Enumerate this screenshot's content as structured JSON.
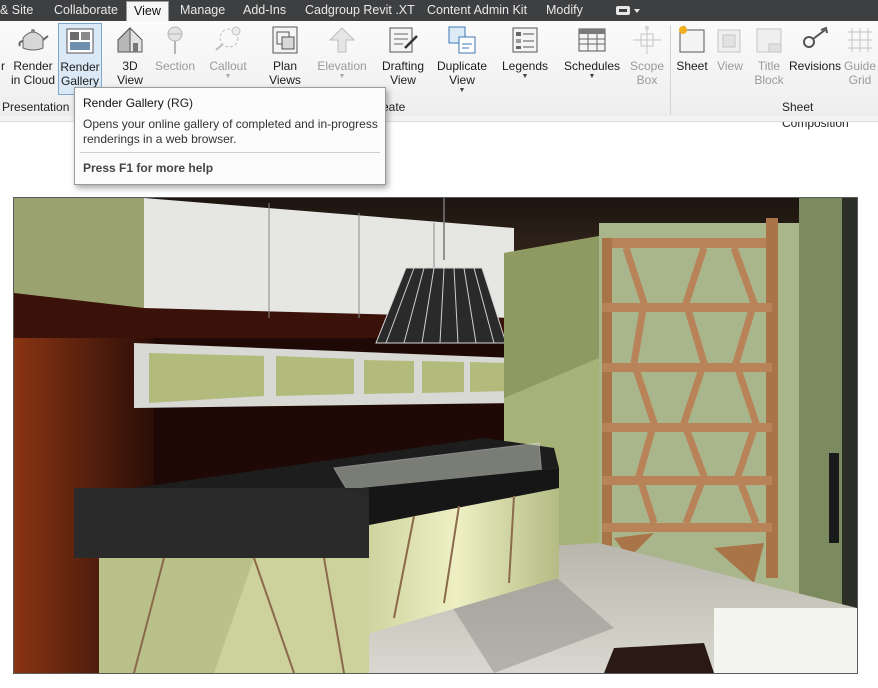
{
  "ribbon": {
    "tabs": [
      {
        "label": "& Site",
        "active": false
      },
      {
        "label": "Collaborate",
        "active": false
      },
      {
        "label": "View",
        "active": true
      },
      {
        "label": "Manage",
        "active": false
      },
      {
        "label": "Add-Ins",
        "active": false
      },
      {
        "label": "Cadgroup Revit .XT",
        "active": false
      },
      {
        "label": "Content Admin Kit",
        "active": false
      },
      {
        "label": "Modify",
        "active": false
      }
    ],
    "tools": [
      {
        "label": "r",
        "icon": "partial-tool-icon",
        "enabled": true
      },
      {
        "label": "Render\nin Cloud",
        "icon": "teapot-cloud-icon",
        "enabled": true
      },
      {
        "label": "Render\nGallery",
        "icon": "render-gallery-icon",
        "enabled": true
      },
      {
        "label": "3D\nView",
        "icon": "house-3d-icon",
        "enabled": true
      },
      {
        "label": "Section",
        "icon": "section-icon",
        "enabled": false
      },
      {
        "label": "Callout",
        "icon": "callout-icon",
        "enabled": false
      },
      {
        "label": "Plan\nViews",
        "icon": "plan-views-icon",
        "enabled": true
      },
      {
        "label": "Elevation",
        "icon": "elevation-icon",
        "enabled": false
      },
      {
        "label": "Drafting\nView",
        "icon": "drafting-view-icon",
        "enabled": true
      },
      {
        "label": "Duplicate\nView",
        "icon": "duplicate-view-icon",
        "enabled": true
      },
      {
        "label": "Legends",
        "icon": "legends-icon",
        "enabled": true
      },
      {
        "label": "Schedules",
        "icon": "schedules-icon",
        "enabled": true
      },
      {
        "label": "Scope\nBox",
        "icon": "scope-box-icon",
        "enabled": false
      },
      {
        "label": "Sheet",
        "icon": "sheet-icon",
        "enabled": true
      },
      {
        "label": "View",
        "icon": "view-placement-icon",
        "enabled": false
      },
      {
        "label": "Title\nBlock",
        "icon": "title-block-icon",
        "enabled": false
      },
      {
        "label": "Revisions",
        "icon": "revisions-icon",
        "enabled": true
      },
      {
        "label": "Guide\nGrid",
        "icon": "guide-grid-icon",
        "enabled": false
      }
    ],
    "panels": [
      "Presentation",
      "eate",
      "Sheet Composition"
    ]
  },
  "tooltip": {
    "title": "Render Gallery",
    "shortcut": "(RG)",
    "body": "Opens your online gallery of completed and in-progress renderings in a web browser.",
    "help": "Press F1 for more help"
  },
  "colors": {
    "tabbar": "#3e3f41",
    "active_tab": "#f6f6f6",
    "hot_tool": "#dbe9f7",
    "wall_green": "#a7b278",
    "wall_red": "#7a2a14",
    "shelf_wood": "#b9835a"
  }
}
